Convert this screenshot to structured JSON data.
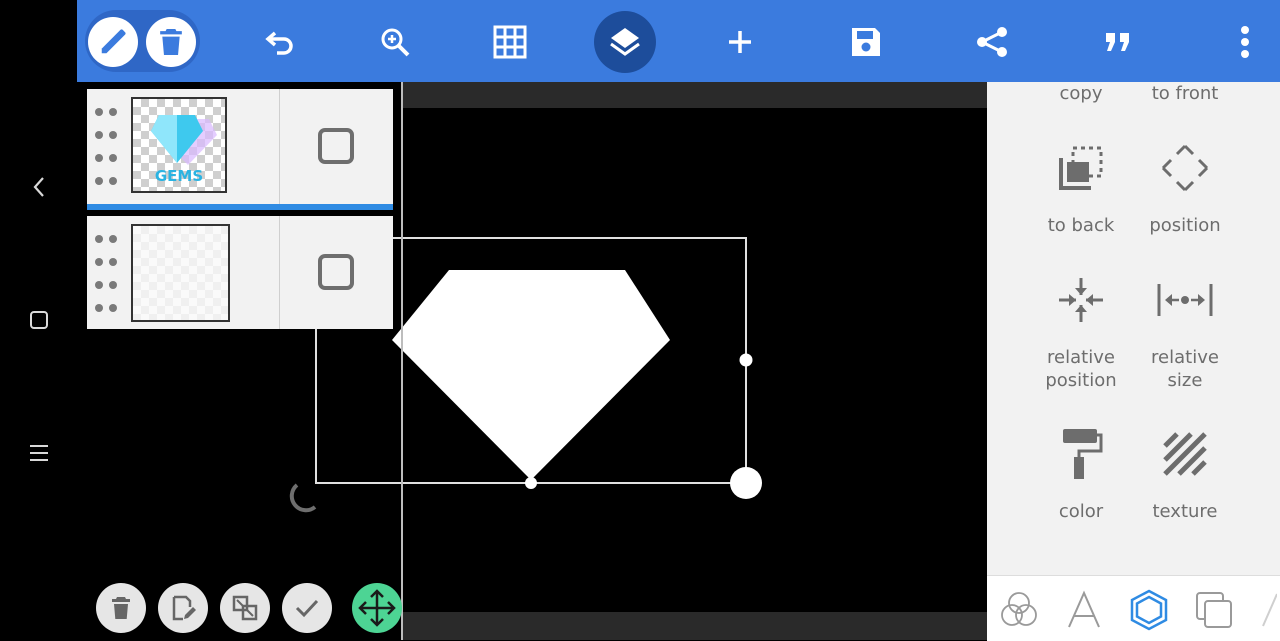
{
  "toolbar": {
    "bg_color": "#3b7bde",
    "buttons": [
      "edit-icon",
      "delete-icon",
      "undo-icon",
      "zoom-in-icon",
      "grid-icon",
      "layers-icon",
      "add-icon",
      "save-icon",
      "share-icon",
      "quote-icon",
      "more-vertical-icon"
    ],
    "active": "layers-icon"
  },
  "sysnav": [
    "back-chevron-icon",
    "home-square-icon",
    "menu-lines-icon"
  ],
  "layers": [
    {
      "thumb_label": "GEMS",
      "selected": true
    },
    {
      "thumb_label": "",
      "selected": false
    }
  ],
  "bottom_actions": [
    "delete-icon",
    "edit-layer-icon",
    "merge-icon",
    "check-icon",
    "move-icon"
  ],
  "right_panel": {
    "items": [
      {
        "label": "copy"
      },
      {
        "label": "to front"
      },
      {
        "label": "to back"
      },
      {
        "label": "position"
      },
      {
        "label": "relative\nposition"
      },
      {
        "label": "relative\nsize"
      },
      {
        "label": "color"
      },
      {
        "label": "texture"
      }
    ]
  },
  "right_tabs": [
    "blend-icon",
    "text-icon",
    "shape-icon",
    "layers-duplicate-icon"
  ],
  "active_tab": "shape-icon",
  "accent_green": "#4dd494",
  "accent_blue": "#2f8be3"
}
